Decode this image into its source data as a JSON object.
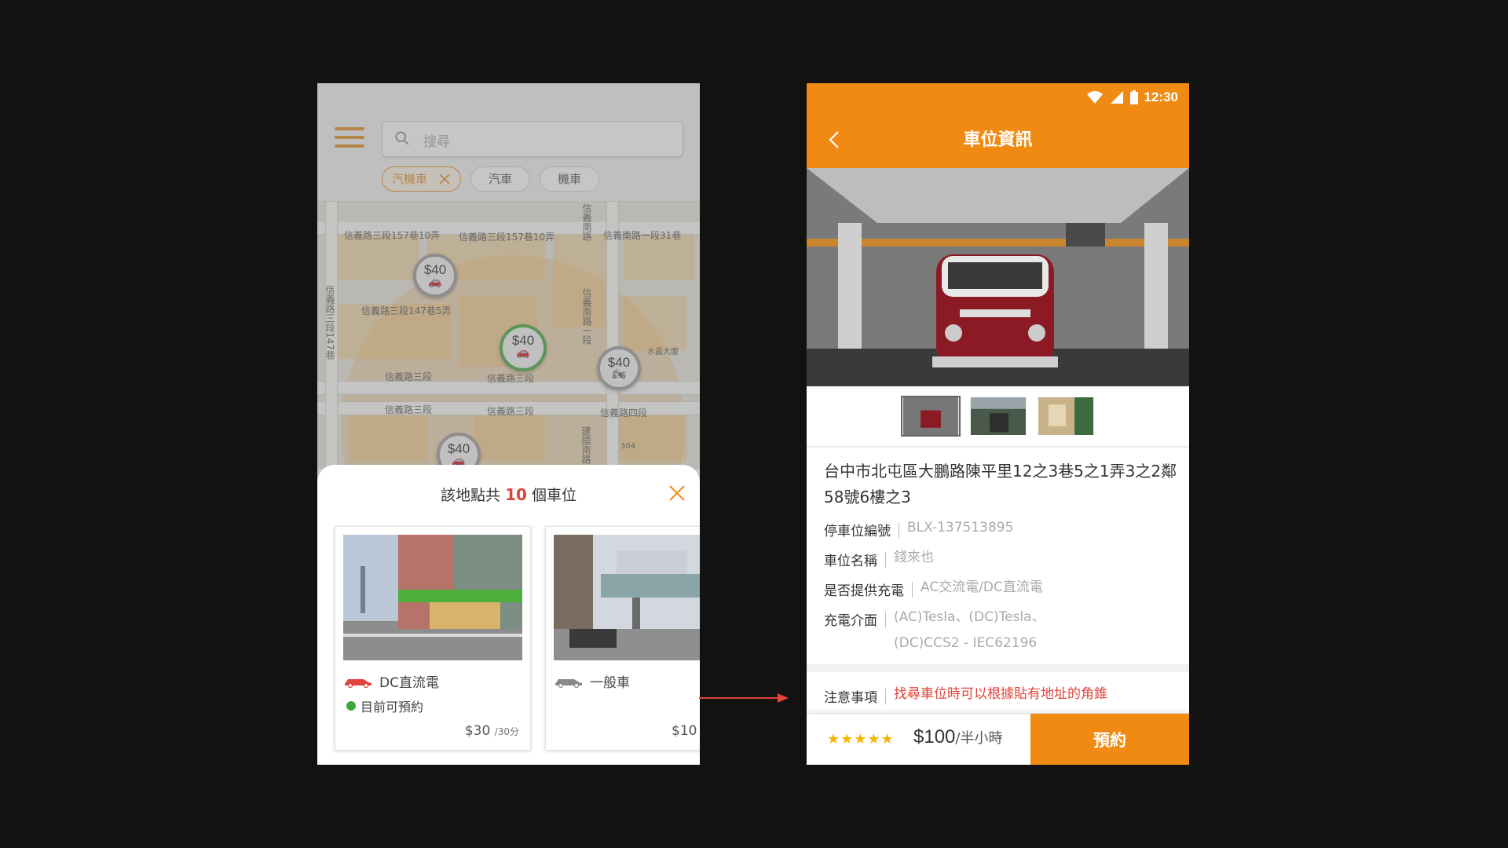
{
  "left_screen": {
    "search": {
      "placeholder": "搜尋"
    },
    "filters": {
      "active": "汽機車",
      "options": [
        "汽車",
        "機車"
      ]
    },
    "map": {
      "street_labels": [
        "信義路三段157巷10弄",
        "信義路三段157巷10弄",
        "信義南路一段31巷",
        "信義路三段147巷5弄",
        "信義路三段",
        "信義路三段",
        "信義路三段",
        "信義路三段",
        "信義路四段",
        "水晶大廈",
        "304"
      ],
      "vertical_labels": [
        "信義南路",
        "信義南路一段",
        "信義路三段147巷",
        "建國南路"
      ],
      "markers": [
        {
          "price": "$40",
          "vehicle": "car"
        },
        {
          "price": "$40",
          "vehicle": "car",
          "selected": true
        },
        {
          "price": "$40",
          "vehicle": "motorcycle"
        },
        {
          "price": "$40",
          "vehicle": "car"
        }
      ]
    },
    "sheet": {
      "title_prefix": "該地點共",
      "count": "10",
      "title_suffix": "個車位",
      "cards": [
        {
          "type_label": "DC直流電",
          "status": "目前可預約",
          "price": "$30",
          "price_unit": "/30分",
          "type_color": "#e0443a"
        },
        {
          "type_label": "一般車",
          "status": "",
          "price": "$10",
          "price_unit": "",
          "type_color": "#888888"
        }
      ]
    }
  },
  "right_screen": {
    "status_bar": {
      "time": "12:30"
    },
    "title": "車位資訊",
    "address": "台中市北屯區大鵬路陳平里12之3巷5之1弄3之2鄰58號6樓之3",
    "info": [
      {
        "key": "停車位編號",
        "value": "BLX-137513895"
      },
      {
        "key": "車位名稱",
        "value": "錢來也"
      },
      {
        "key": "是否提供充電",
        "value": "AC交流電/DC直流電"
      },
      {
        "key": "充電介面",
        "value": "(AC)Tesla、(DC)Tesla、(DC)CCS2 - IEC62196"
      }
    ],
    "notice": {
      "key": "注意事項",
      "value": "找尋車位時可以根據貼有地址的角錐"
    },
    "rating_stars": "★★★★★",
    "price": "$100",
    "price_unit": "/半小時",
    "book_label": "預約"
  },
  "colors": {
    "brand_orange": "#f08a12",
    "accent_red": "#e0443a",
    "available_green": "#3ea63a",
    "background": "#121212"
  }
}
